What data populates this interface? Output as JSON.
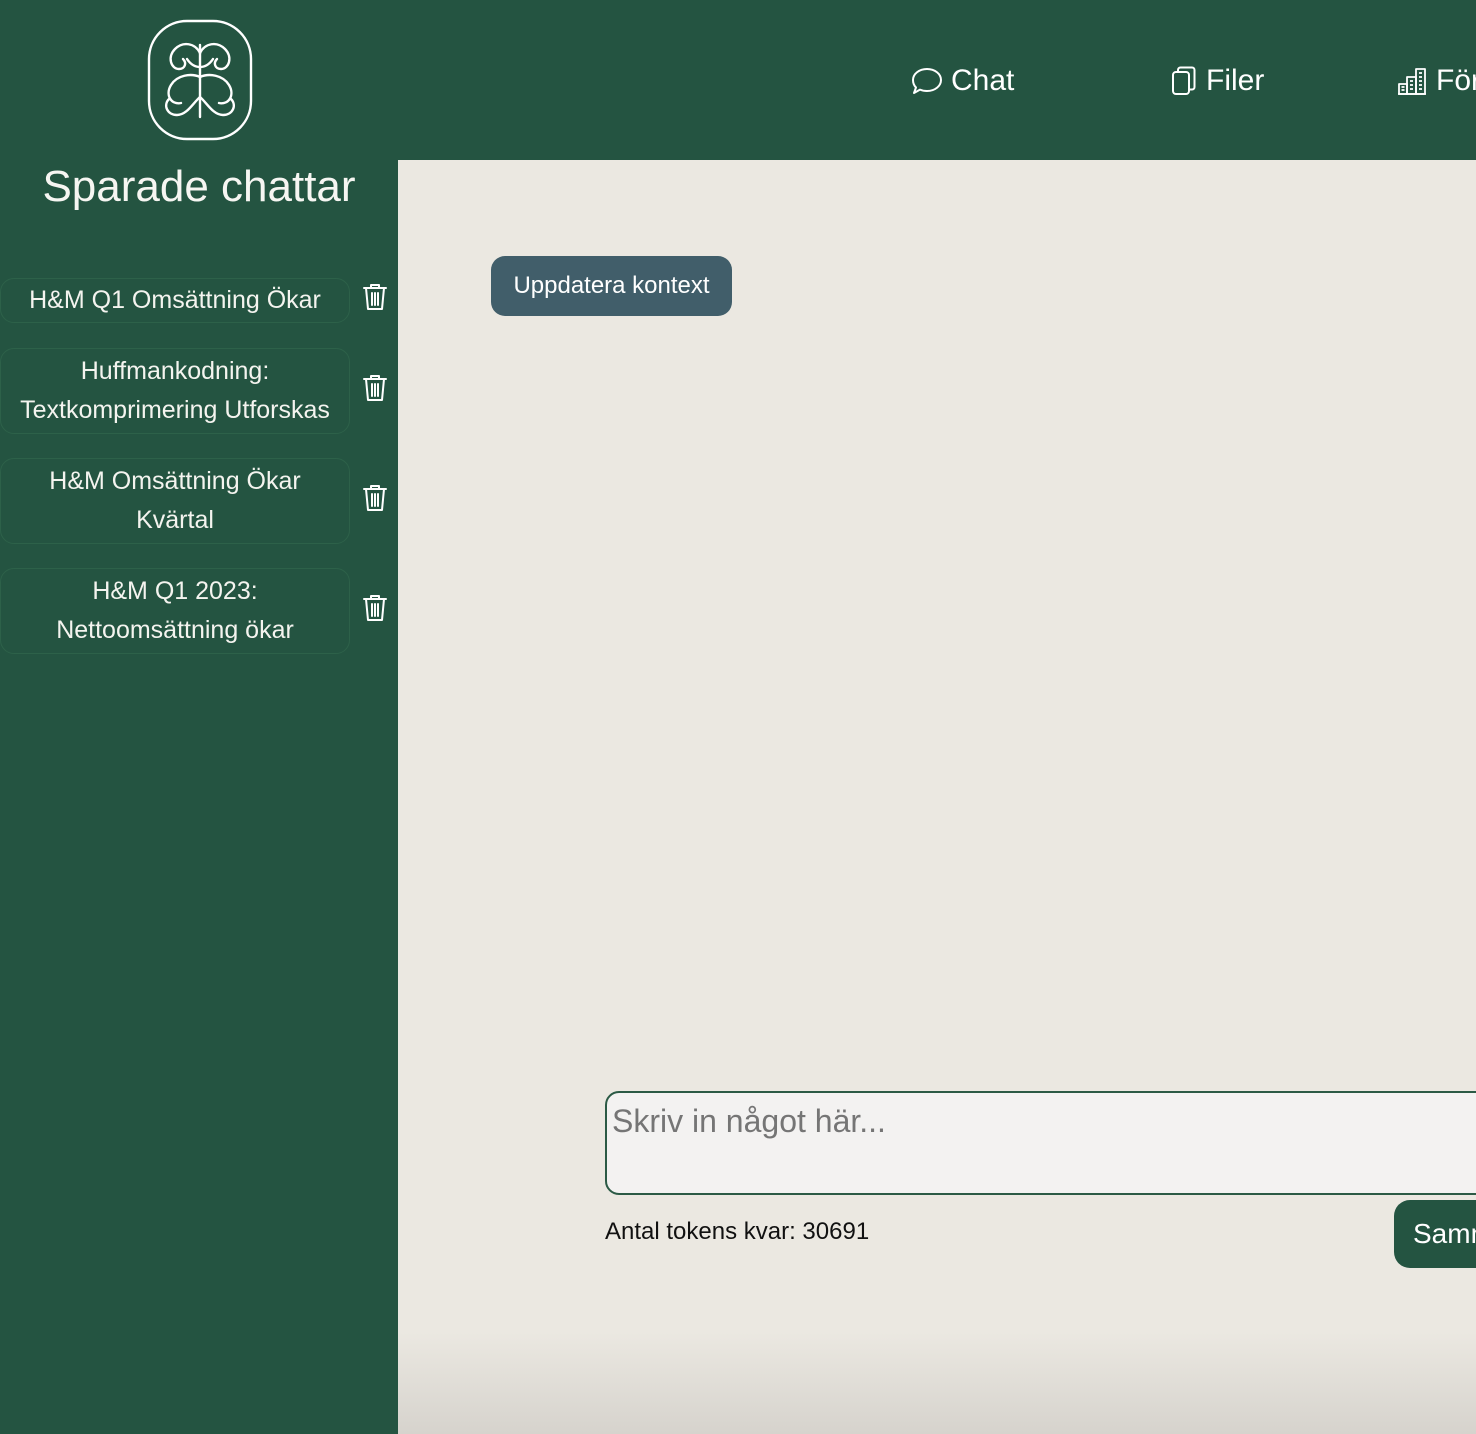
{
  "sidebar": {
    "logo_icon": "brain-logo-icon",
    "title": "Sparade chattar",
    "chats": [
      {
        "label": "H&M Q1 Omsättning Ökar"
      },
      {
        "label": "Huffmankodning: Textkomprimering Utforskas"
      },
      {
        "label": "H&M Omsättning Ökar Kvärtal"
      },
      {
        "label": "H&M Q1 2023: Nettoomsättning ökar"
      }
    ],
    "delete_icon": "trash-icon"
  },
  "nav": {
    "chat_label": "Chat",
    "chat_icon": "speech-bubble-icon",
    "files_label": "Filer",
    "files_icon": "copy-files-icon",
    "third_label": "För",
    "third_icon": "building-chart-icon"
  },
  "main": {
    "update_button": "Uppdatera kontext",
    "input_placeholder": "Skriv in något här...",
    "tokens_text": "Antal tokens kvar: 30691",
    "send_button": "Samm"
  },
  "colors": {
    "primary_green": "#245441",
    "background": "#ebe8e1",
    "update_button": "#415e6a"
  }
}
